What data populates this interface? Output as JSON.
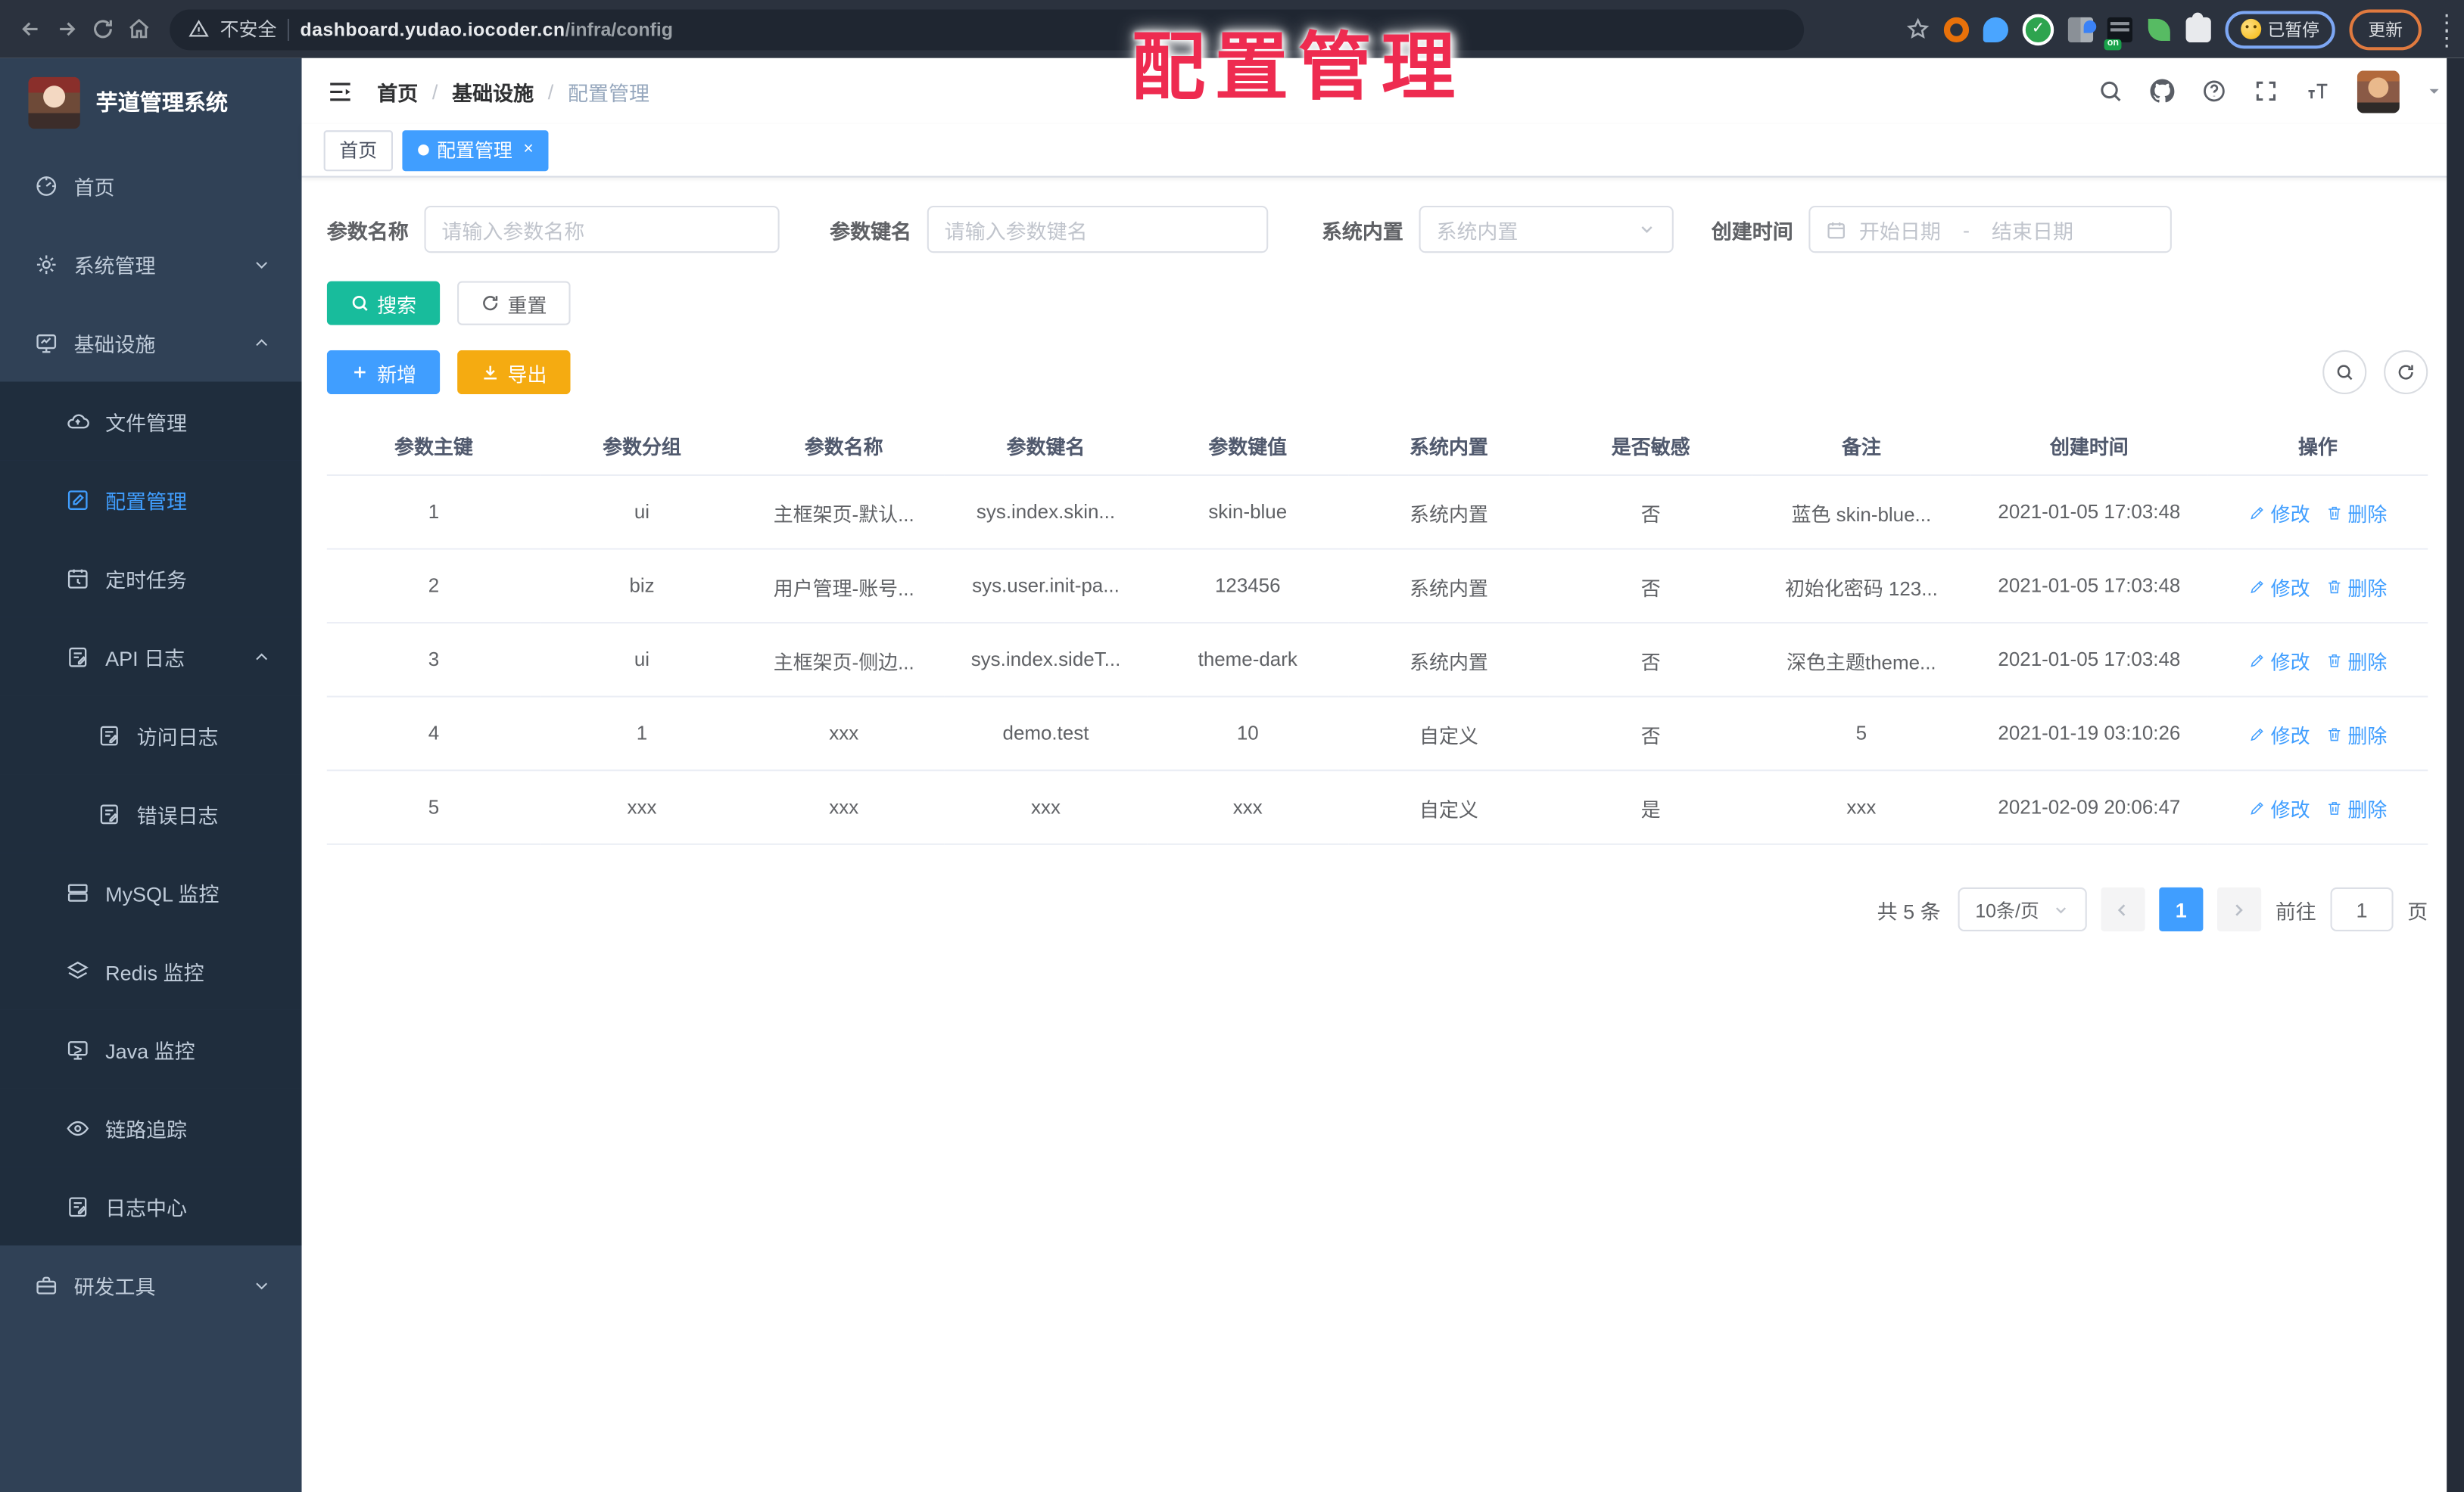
{
  "browser": {
    "security_label": "不安全",
    "url_host": "dashboard.yudao.iocoder.cn",
    "url_path": "/infra/config",
    "extension_badge": "on",
    "paused_label": "已暂停",
    "update_label": "更新",
    "extensions": [
      "star-icon",
      "ext-ring-icon",
      "ext-pin-icon",
      "ext-check-icon",
      "ext-grid-icon",
      "ext-bars-icon",
      "ext-leaf-icon",
      "ext-puzzle-icon"
    ]
  },
  "overlay": {
    "title": "配置管理"
  },
  "sidebar": {
    "app_title": "芋道管理系统",
    "items": [
      {
        "label": "首页",
        "icon": "dashboard-icon",
        "level": 1
      },
      {
        "label": "系统管理",
        "icon": "gear-icon",
        "level": 1,
        "chevron": "down"
      },
      {
        "label": "基础设施",
        "icon": "infra-icon",
        "level": 1,
        "chevron": "up"
      },
      {
        "label": "文件管理",
        "icon": "cloud-icon",
        "level": 2
      },
      {
        "label": "配置管理",
        "icon": "edit-square-icon",
        "level": 2,
        "active": true
      },
      {
        "label": "定时任务",
        "icon": "schedule-icon",
        "level": 2
      },
      {
        "label": "API 日志",
        "icon": "doc-log-icon",
        "level": 2,
        "chevron": "up"
      },
      {
        "label": "访问日志",
        "icon": "doc-log-icon",
        "level": 3
      },
      {
        "label": "错误日志",
        "icon": "doc-log-icon",
        "level": 3
      },
      {
        "label": "MySQL 监控",
        "icon": "server-icon",
        "level": 2
      },
      {
        "label": "Redis 监控",
        "icon": "layers-icon",
        "level": 2
      },
      {
        "label": "Java 监控",
        "icon": "monitor-icon",
        "level": 2
      },
      {
        "label": "链路追踪",
        "icon": "eye-icon",
        "level": 2
      },
      {
        "label": "日志中心",
        "icon": "doc-log-icon",
        "level": 2
      },
      {
        "label": "研发工具",
        "icon": "briefcase-icon",
        "level": 1,
        "chevron": "down"
      }
    ]
  },
  "header": {
    "breadcrumb": [
      "首页",
      "基础设施",
      "配置管理"
    ],
    "breadcrumb_separator": "/"
  },
  "tags": [
    {
      "label": "首页",
      "active": false
    },
    {
      "label": "配置管理",
      "active": true
    }
  ],
  "filters": [
    {
      "label": "参数名称",
      "placeholder": "请输入参数名称",
      "type": "input"
    },
    {
      "label": "参数键名",
      "placeholder": "请输入参数键名",
      "type": "input"
    },
    {
      "label": "系统内置",
      "placeholder": "系统内置",
      "type": "select"
    },
    {
      "label": "创建时间",
      "start": "开始日期",
      "separator": "-",
      "end": "结束日期",
      "type": "daterange"
    }
  ],
  "toolbar": {
    "search_label": "搜索",
    "reset_label": "重置",
    "add_label": "新增",
    "export_label": "导出"
  },
  "table": {
    "columns": [
      "参数主键",
      "参数分组",
      "参数名称",
      "参数键名",
      "参数键值",
      "系统内置",
      "是否敏感",
      "备注",
      "创建时间",
      "操作"
    ],
    "actions": {
      "edit_label": "修改",
      "delete_label": "删除"
    },
    "rows": [
      {
        "id": "1",
        "group": "ui",
        "name": "主框架页-默认...",
        "key": "sys.index.skin...",
        "value": "skin-blue",
        "builtin": "系统内置",
        "sensitive": "否",
        "remark": "蓝色 skin-blue...",
        "created": "2021-01-05 17:03:48"
      },
      {
        "id": "2",
        "group": "biz",
        "name": "用户管理-账号...",
        "key": "sys.user.init-pa...",
        "value": "123456",
        "builtin": "系统内置",
        "sensitive": "否",
        "remark": "初始化密码 123...",
        "created": "2021-01-05 17:03:48"
      },
      {
        "id": "3",
        "group": "ui",
        "name": "主框架页-侧边...",
        "key": "sys.index.sideT...",
        "value": "theme-dark",
        "builtin": "系统内置",
        "sensitive": "否",
        "remark": "深色主题theme...",
        "created": "2021-01-05 17:03:48"
      },
      {
        "id": "4",
        "group": "1",
        "name": "xxx",
        "key": "demo.test",
        "value": "10",
        "builtin": "自定义",
        "sensitive": "否",
        "remark": "5",
        "created": "2021-01-19 03:10:26"
      },
      {
        "id": "5",
        "group": "xxx",
        "name": "xxx",
        "key": "xxx",
        "value": "xxx",
        "builtin": "自定义",
        "sensitive": "是",
        "remark": "xxx",
        "created": "2021-02-09 20:06:47"
      }
    ]
  },
  "pagination": {
    "total_label": "共 5 条",
    "page_size_label": "10条/页",
    "current_page": "1",
    "goto_label": "前往",
    "goto_value": "1",
    "page_suffix": "页"
  },
  "colors": {
    "accent_blue": "#409eff",
    "search_teal": "#18bc9c",
    "export_amber": "#f5ab11",
    "sidebar_bg": "#304156",
    "submenu_bg": "#1f2d3d",
    "annotation_red": "#ee2b50"
  }
}
